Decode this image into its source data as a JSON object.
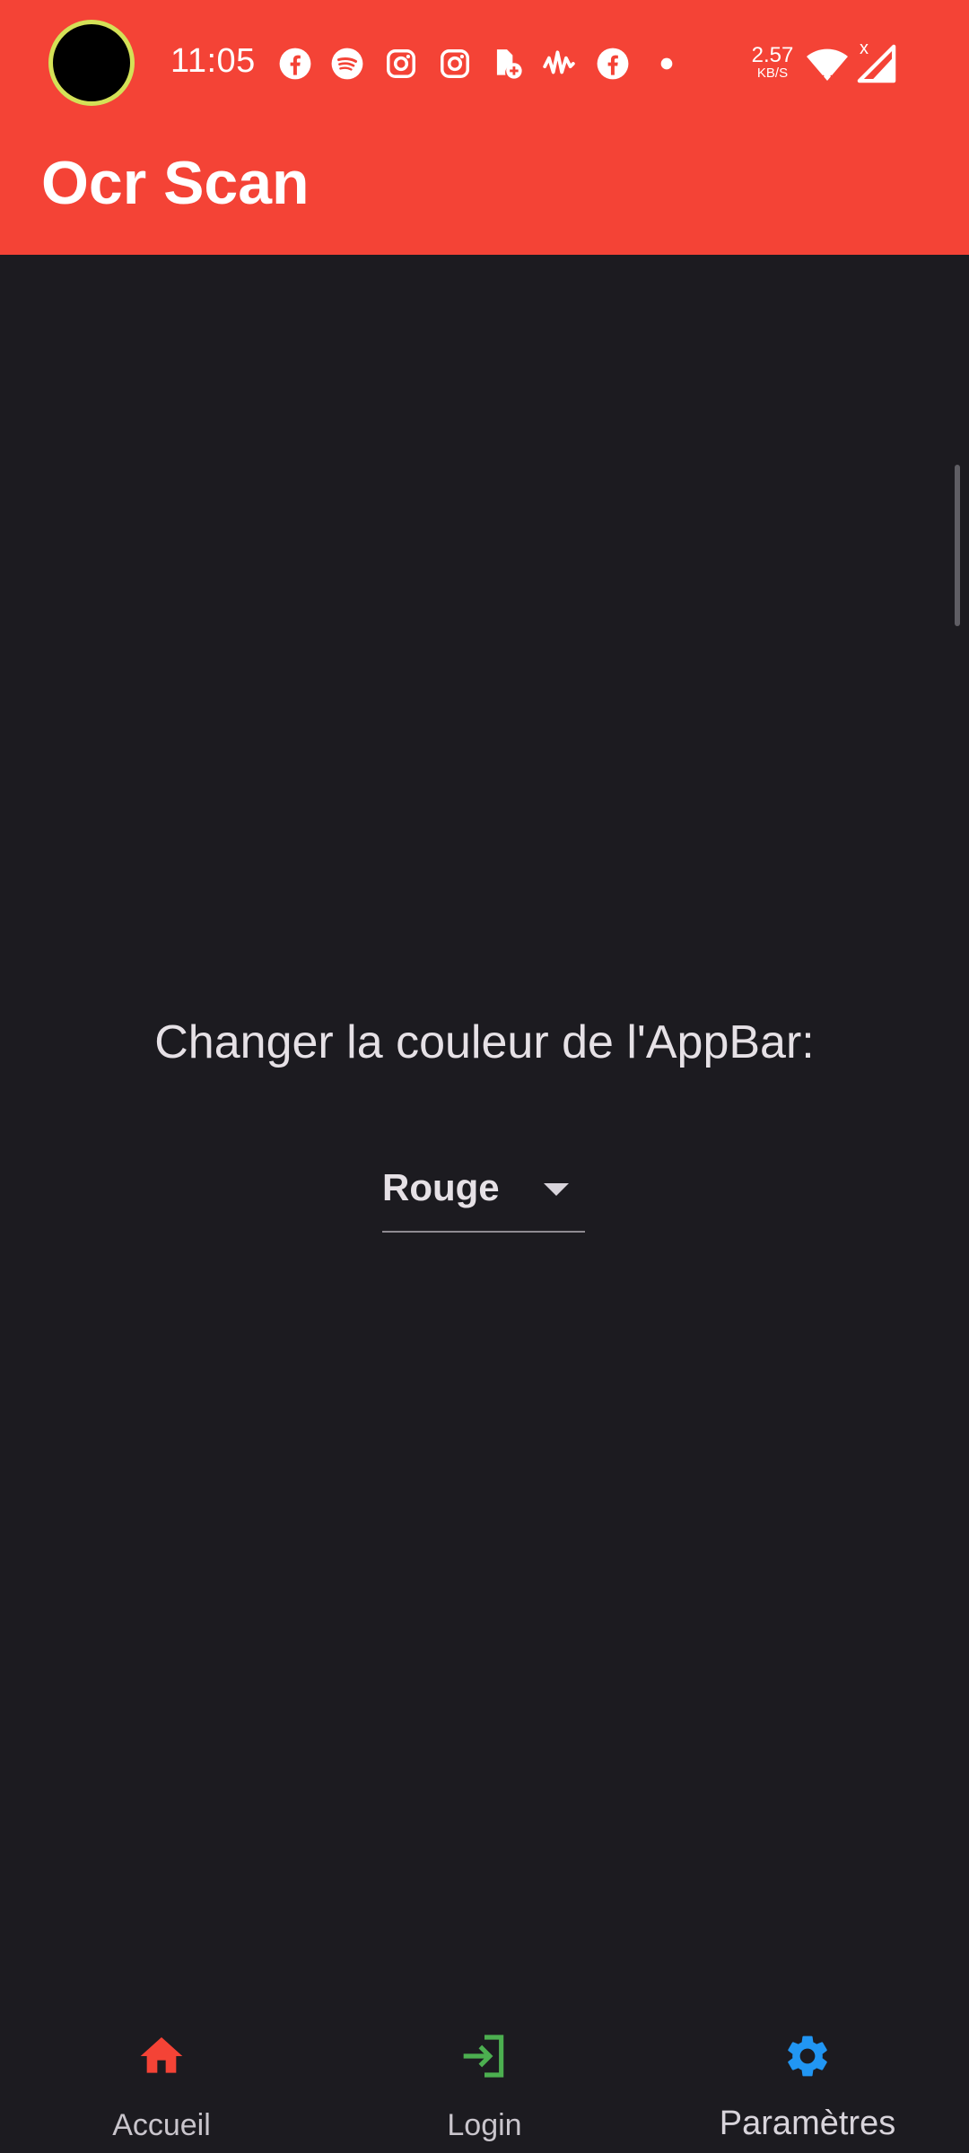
{
  "status_bar": {
    "time": "11:05",
    "net_speed_value": "2.57",
    "net_speed_unit": "KB/S",
    "signal_flag": "x",
    "icons": [
      "facebook-icon",
      "spotify-icon",
      "instagram-icon",
      "instagram-icon",
      "sim-add-icon",
      "waveform-icon",
      "facebook-icon",
      "dot-icon",
      "wifi-icon",
      "signal-icon"
    ]
  },
  "app_bar": {
    "title": "Ocr Scan",
    "color": "#f44336"
  },
  "settings": {
    "label": "Changer la couleur de l'AppBar:",
    "dropdown_value": "Rouge"
  },
  "bottom_nav": {
    "items": [
      {
        "label": "Accueil",
        "icon": "home-icon",
        "color": "#f44336"
      },
      {
        "label": "Login",
        "icon": "login-icon",
        "color": "#4caf50"
      },
      {
        "label": "Paramètres",
        "icon": "gear-icon",
        "color": "#2196f3",
        "selected": true
      }
    ]
  },
  "colors": {
    "background": "#1c1b20",
    "text": "#e6e1e6"
  }
}
